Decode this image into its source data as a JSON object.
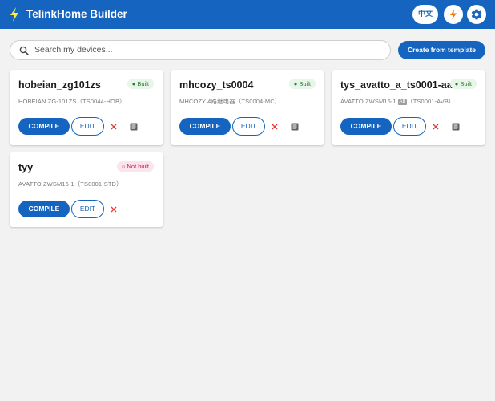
{
  "app": {
    "title": "TelinkHome Builder"
  },
  "header": {
    "lang_label": "中文"
  },
  "search": {
    "placeholder": "Search my devices..."
  },
  "toolbar": {
    "create_label": "Create from template"
  },
  "actions": {
    "compile_label": "COMPILE",
    "edit_label": "EDIT"
  },
  "devices": [
    {
      "name": "hobeian_zg101zs",
      "status": "Built",
      "model": "HOBEIAN ZG-101ZS",
      "model_tag": "",
      "model_code": "（TS0044-HOB）"
    },
    {
      "name": "mhcozy_ts0004",
      "status": "Built",
      "model": "MHCOZY 4路继电器",
      "model_tag": "",
      "model_code": "（TS0004-MC）"
    },
    {
      "name": "tys_avatto_a_ts0001-aa",
      "status": "Built",
      "model": "AVATTO ZWSM16-1",
      "model_tag": "AB",
      "model_code": "（TS0001-AVB）"
    },
    {
      "name": "tyy",
      "status": "Not built",
      "model": "AVATTO ZWSM16-1",
      "model_tag": "",
      "model_code": "（TS0001-STD）"
    }
  ],
  "colors": {
    "primary": "#1565c0",
    "built_bg": "#e8f5e9",
    "built_fg": "#2e7d32",
    "notbuilt_bg": "#fce4ec",
    "notbuilt_fg": "#c2185b",
    "delete": "#e53935"
  }
}
